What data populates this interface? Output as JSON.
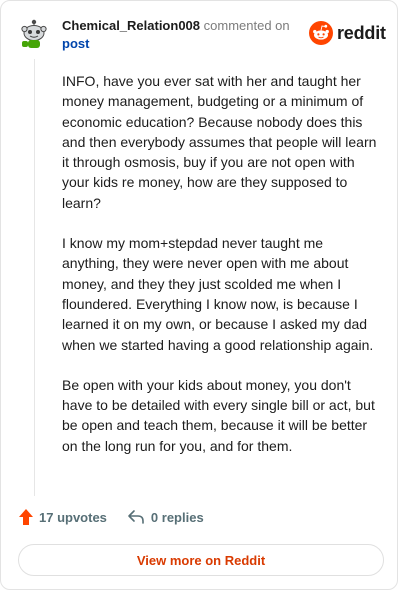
{
  "header": {
    "username": "Chemical_Relation008",
    "commented_on": "commented on",
    "post_link": "post"
  },
  "brand": {
    "name": "reddit",
    "color": "#ff4500"
  },
  "comment": {
    "paragraphs": [
      "INFO, have you ever sat with her and taught her money management, budgeting or a minimum of economic education? Because nobody does this and then everybody assumes that people will learn it through osmosis, buy if you are not open with your kids re money, how are they supposed to learn?",
      "I know my mom+stepdad never taught me anything, they were never open with me about money, and they they just scolded me when I floundered. Everything I know now, is because I learned it on my own, or because I asked my dad when we started having a good relationship again.",
      "Be open with your kids about money, you don't have to be detailed with every single bill or act, but be open and teach them, because it will be better on the long run for you, and for them."
    ]
  },
  "actions": {
    "upvotes": "17 upvotes",
    "replies": "0 replies",
    "upvote_icon": "arrow-up-icon",
    "reply_icon": "reply-arrow-icon"
  },
  "footer": {
    "view_more": "View more on Reddit"
  }
}
